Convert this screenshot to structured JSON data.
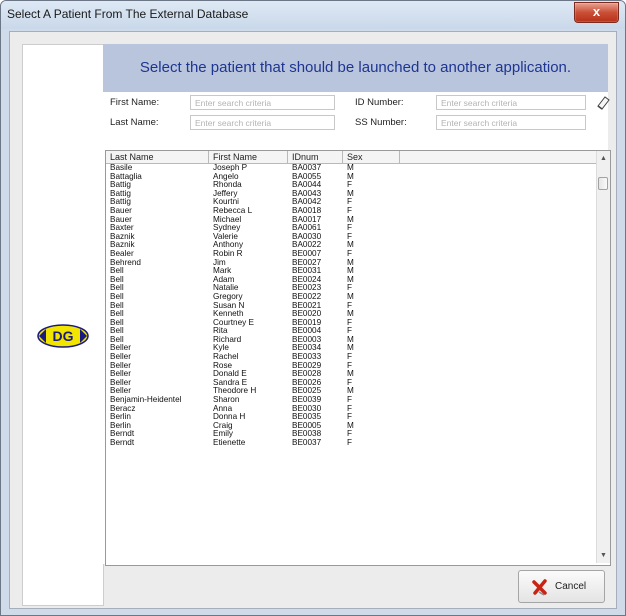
{
  "window": {
    "title": "Select A Patient From The External Database",
    "close_glyph": "x"
  },
  "banner": "Select the patient that should be launched to another application.",
  "search": {
    "first_name_label": "First Name:",
    "last_name_label": "Last Name:",
    "id_number_label": "ID Number:",
    "ss_number_label": "SS Number:",
    "placeholder": "Enter search criteria"
  },
  "grid": {
    "columns": [
      "Last Name",
      "First Name",
      "IDnum",
      "Sex"
    ],
    "rows": [
      [
        "Basile",
        "Joseph P",
        "BA0037",
        "M"
      ],
      [
        "Battaglia",
        "Angelo",
        "BA0055",
        "M"
      ],
      [
        "Battig",
        "Rhonda",
        "BA0044",
        "F"
      ],
      [
        "Battig",
        "Jeffery",
        "BA0043",
        "M"
      ],
      [
        "Battig",
        "Kourtni",
        "BA0042",
        "F"
      ],
      [
        "Bauer",
        "Rebecca L",
        "BA0018",
        "F"
      ],
      [
        "Bauer",
        "Michael",
        "BA0017",
        "M"
      ],
      [
        "Baxter",
        "Sydney",
        "BA0061",
        "F"
      ],
      [
        "Baznik",
        "Valerie",
        "BA0030",
        "F"
      ],
      [
        "Baznik",
        "Anthony",
        "BA0022",
        "M"
      ],
      [
        "Bealer",
        "Robin R",
        "BE0007",
        "F"
      ],
      [
        "Behrend",
        "Jim",
        "BE0027",
        "M"
      ],
      [
        "Bell",
        "Mark",
        "BE0031",
        "M"
      ],
      [
        "Bell",
        "Adam",
        "BE0024",
        "M"
      ],
      [
        "Bell",
        "Natalie",
        "BE0023",
        "F"
      ],
      [
        "Bell",
        "Gregory",
        "BE0022",
        "M"
      ],
      [
        "Bell",
        "Susan N",
        "BE0021",
        "F"
      ],
      [
        "Bell",
        "Kenneth",
        "BE0020",
        "M"
      ],
      [
        "Bell",
        "Courtney E",
        "BE0019",
        "F"
      ],
      [
        "Bell",
        "Rita",
        "BE0004",
        "F"
      ],
      [
        "Bell",
        "Richard",
        "BE0003",
        "M"
      ],
      [
        "Beller",
        "Kyle",
        "BE0034",
        "M"
      ],
      [
        "Beller",
        "Rachel",
        "BE0033",
        "F"
      ],
      [
        "Beller",
        "Rose",
        "BE0029",
        "F"
      ],
      [
        "Beller",
        "Donald E",
        "BE0028",
        "M"
      ],
      [
        "Beller",
        "Sandra E",
        "BE0026",
        "F"
      ],
      [
        "Beller",
        "Theodore H",
        "BE0025",
        "M"
      ],
      [
        "Benjamin-Heidentel",
        "Sharon",
        "BE0039",
        "F"
      ],
      [
        "Beracz",
        "Anna",
        "BE0030",
        "F"
      ],
      [
        "Berlin",
        "Donna H",
        "BE0035",
        "F"
      ],
      [
        "Berlin",
        "Craig",
        "BE0005",
        "M"
      ],
      [
        "Berndt",
        "Emily",
        "BE0038",
        "F"
      ],
      [
        "Berndt",
        "Etienette",
        "BE0037",
        "F"
      ]
    ]
  },
  "cancel_label": "Cancel",
  "logo_text": "DG",
  "colors": {
    "banner_bg": "#b9c5dd",
    "banner_text": "#1e3591",
    "logo_fill": "#f2e600"
  },
  "icons": {
    "eraser": "eraser-icon",
    "cancel": "red-x-icon",
    "logo": "dg-logo-icon"
  }
}
